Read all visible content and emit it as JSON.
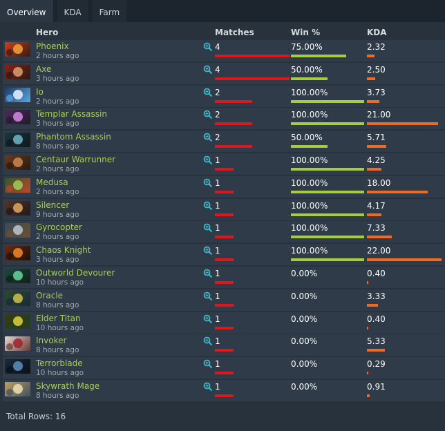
{
  "tabs": [
    {
      "label": "Overview",
      "active": true
    },
    {
      "label": "KDA",
      "active": false
    },
    {
      "label": "Farm",
      "active": false
    }
  ],
  "columns": {
    "hero": "Hero",
    "matches": "Matches",
    "win": "Win %",
    "kda": "KDA"
  },
  "rows": [
    {
      "hero": "Phoenix",
      "time": "2 hours ago",
      "matches": "4",
      "win": "75.00%",
      "kda": "2.32",
      "matches_frac": 1.0,
      "win_frac": 0.75,
      "kda_frac": 0.105,
      "colors": [
        "#c6401c",
        "#f2a23b",
        "#3a1a10"
      ]
    },
    {
      "hero": "Axe",
      "time": "3 hours ago",
      "matches": "4",
      "win": "50.00%",
      "kda": "2.50",
      "matches_frac": 1.0,
      "win_frac": 0.5,
      "kda_frac": 0.114,
      "colors": [
        "#8a2117",
        "#d8a070",
        "#2b1a14"
      ]
    },
    {
      "hero": "Io",
      "time": "2 hours ago",
      "matches": "2",
      "win": "100.00%",
      "kda": "3.73",
      "matches_frac": 0.5,
      "win_frac": 1.0,
      "kda_frac": 0.17,
      "colors": [
        "#1b3a6b",
        "#e8f4ff",
        "#5aa7e0"
      ]
    },
    {
      "hero": "Templar Assassin",
      "time": "3 hours ago",
      "matches": "2",
      "win": "100.00%",
      "kda": "21.00",
      "matches_frac": 0.5,
      "win_frac": 1.0,
      "kda_frac": 0.955,
      "colors": [
        "#4b2a5e",
        "#d28be0",
        "#231a2a"
      ]
    },
    {
      "hero": "Phantom Assassin",
      "time": "8 hours ago",
      "matches": "2",
      "win": "50.00%",
      "kda": "5.71",
      "matches_frac": 0.5,
      "win_frac": 0.5,
      "kda_frac": 0.26,
      "colors": [
        "#1a3640",
        "#6fb6c4",
        "#10181c"
      ]
    },
    {
      "hero": "Centaur Warrunner",
      "time": "2 hours ago",
      "matches": "1",
      "win": "100.00%",
      "kda": "4.25",
      "matches_frac": 0.25,
      "win_frac": 1.0,
      "kda_frac": 0.193,
      "colors": [
        "#6a3a1c",
        "#c88850",
        "#2a1a10"
      ]
    },
    {
      "hero": "Medusa",
      "time": "2 hours ago",
      "matches": "1",
      "win": "100.00%",
      "kda": "18.00",
      "matches_frac": 0.25,
      "win_frac": 1.0,
      "kda_frac": 0.818,
      "colors": [
        "#2e5a2a",
        "#9ccc5a",
        "#c0452a"
      ]
    },
    {
      "hero": "Silencer",
      "time": "9 hours ago",
      "matches": "1",
      "win": "100.00%",
      "kda": "4.17",
      "matches_frac": 0.25,
      "win_frac": 1.0,
      "kda_frac": 0.19,
      "colors": [
        "#5a3420",
        "#e0a860",
        "#201820"
      ]
    },
    {
      "hero": "Gyrocopter",
      "time": "2 hours ago",
      "matches": "1",
      "win": "100.00%",
      "kda": "7.33",
      "matches_frac": 0.25,
      "win_frac": 1.0,
      "kda_frac": 0.333,
      "colors": [
        "#3a4a5a",
        "#b8c8d0",
        "#6a5030"
      ]
    },
    {
      "hero": "Chaos Knight",
      "time": "3 hours ago",
      "matches": "1",
      "win": "100.00%",
      "kda": "22.00",
      "matches_frac": 0.25,
      "win_frac": 1.0,
      "kda_frac": 1.0,
      "colors": [
        "#6a2a10",
        "#f08a2a",
        "#201008"
      ]
    },
    {
      "hero": "Outworld Devourer",
      "time": "10 hours ago",
      "matches": "1",
      "win": "0.00%",
      "kda": "0.40",
      "matches_frac": 0.25,
      "win_frac": 0,
      "kda_frac": 0.018,
      "colors": [
        "#1a4a3a",
        "#6ad0a0",
        "#102018"
      ]
    },
    {
      "hero": "Oracle",
      "time": "8 hours ago",
      "matches": "1",
      "win": "0.00%",
      "kda": "3.33",
      "matches_frac": 0.25,
      "win_frac": 0,
      "kda_frac": 0.151,
      "colors": [
        "#2a4a2a",
        "#d0c050",
        "#1a2a3a"
      ]
    },
    {
      "hero": "Elder Titan",
      "time": "10 hours ago",
      "matches": "1",
      "win": "0.00%",
      "kda": "0.40",
      "matches_frac": 0.25,
      "win_frac": 0,
      "kda_frac": 0.018,
      "colors": [
        "#3a3a10",
        "#e0d040",
        "#204020"
      ]
    },
    {
      "hero": "Invoker",
      "time": "8 hours ago",
      "matches": "1",
      "win": "0.00%",
      "kda": "5.33",
      "matches_frac": 0.25,
      "win_frac": 0,
      "kda_frac": 0.242,
      "colors": [
        "#e8d8d0",
        "#a02030",
        "#6a3a30"
      ]
    },
    {
      "hero": "Terrorblade",
      "time": "10 hours ago",
      "matches": "1",
      "win": "0.00%",
      "kda": "0.29",
      "matches_frac": 0.25,
      "win_frac": 0,
      "kda_frac": 0.013,
      "colors": [
        "#1a2a3a",
        "#5a90c0",
        "#0a1018"
      ]
    },
    {
      "hero": "Skywrath Mage",
      "time": "8 hours ago",
      "matches": "1",
      "win": "0.00%",
      "kda": "0.91",
      "matches_frac": 0.25,
      "win_frac": 0,
      "kda_frac": 0.041,
      "colors": [
        "#c0a060",
        "#f0e0b0",
        "#405060"
      ]
    }
  ],
  "footer": {
    "total": "Total Rows: 16"
  },
  "colors": {
    "hero_name": "#a9cf54",
    "matches_bar": "#e0161a",
    "win_bar": "#a6ce3c",
    "kda_bar": "#ef6b22",
    "row_bg": "#2f3b48",
    "panel_bg": "#28323d"
  },
  "icons": {
    "row_action": "zoom-in-icon"
  }
}
